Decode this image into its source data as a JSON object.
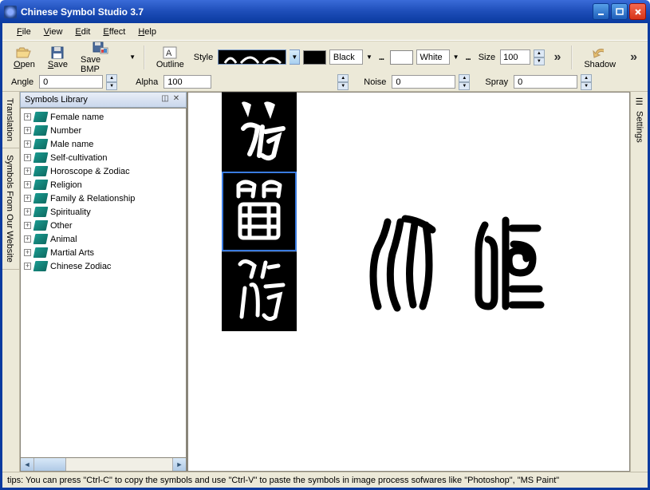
{
  "title": "Chinese Symbol Studio 3.7",
  "menubar": {
    "file": "File",
    "view": "View",
    "edit": "Edit",
    "effect": "Effect",
    "help": "Help"
  },
  "toolbar": {
    "open": "Open",
    "save": "Save",
    "save_bmp": "Save BMP",
    "outline": "Outline",
    "style": "Style",
    "color1_name": "Black",
    "color1_hex": "#000000",
    "color2_name": "White",
    "color2_hex": "#ffffff",
    "size_label": "Size",
    "size_value": "100",
    "shadow": "Shadow"
  },
  "toolbar2": {
    "angle_label": "Angle",
    "angle_value": "0",
    "alpha_label": "Alpha",
    "alpha_value": "100",
    "noise_label": "Noise",
    "noise_value": "0",
    "spray_label": "Spray",
    "spray_value": "0"
  },
  "vtabs": {
    "translation": "Translation",
    "website": "Symbols From Our Website"
  },
  "library": {
    "title": "Symbols Library",
    "items": [
      {
        "label": "Female name"
      },
      {
        "label": "Number"
      },
      {
        "label": "Male name"
      },
      {
        "label": "Self-cultivation"
      },
      {
        "label": "Horoscope & Zodiac"
      },
      {
        "label": "Religion"
      },
      {
        "label": "Family & Relationship"
      },
      {
        "label": "Spirituality"
      },
      {
        "label": "Other"
      },
      {
        "label": "Animal"
      },
      {
        "label": "Martial Arts"
      },
      {
        "label": "Chinese Zodiac"
      }
    ]
  },
  "rtab": {
    "settings": "Settings"
  },
  "statusbar": "tips: You can press \"Ctrl-C\" to copy the symbols and use \"Ctrl-V\" to paste the symbols in image process sofwares like \"Photoshop\", \"MS Paint\""
}
